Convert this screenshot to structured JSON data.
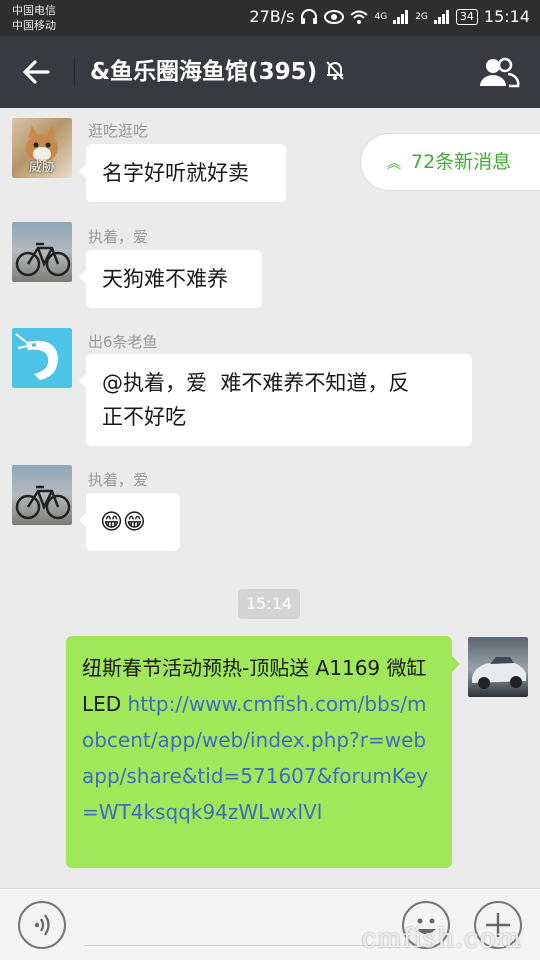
{
  "status_bar": {
    "carrier_1": "中国电信",
    "carrier_2": "中国移动",
    "speed": "27B/s",
    "sig_4g": "4G",
    "sig_2g": "2G",
    "battery": "34",
    "time": "15:14"
  },
  "header": {
    "title": "&鱼乐圈海鱼馆(395)"
  },
  "new_messages": {
    "label": "72条新消息"
  },
  "messages": [
    {
      "sender": "逛吃逛吃",
      "avatar_text": "威胁",
      "text": "名字好听就好卖"
    },
    {
      "sender": "执着，爱",
      "text": "天狗难不难养"
    },
    {
      "sender": "出6条老鱼",
      "text_line1": "@执着，爱  难不难养不知道，反",
      "text_line2": "正不好吃"
    },
    {
      "sender": "执着，爱",
      "emoji": "😁😁"
    }
  ],
  "timestamp": "15:14",
  "own_message": {
    "text_prefix": "纽斯春节活动预热-顶贴送 A1169 微缸 LED ",
    "link": "http://www.cmfish.com/bbs/mobcent/app/web/index.php?r=webapp/share&tid=571607&forumKey=WT4ksqqk94zWLwxlVl"
  },
  "watermark": "cmfish.com",
  "colors": {
    "title_bar": "#393a3f",
    "own_bubble": "#a0e75a",
    "accent_green": "#3eae31",
    "link": "#3c6ebf"
  }
}
